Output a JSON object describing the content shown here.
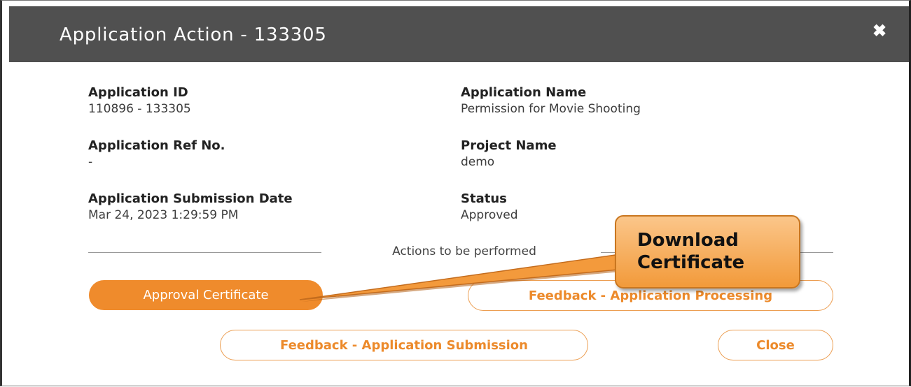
{
  "modal": {
    "title": "Application Action - 133305",
    "close_icon": "close-icon"
  },
  "details": {
    "application_id": {
      "label": "Application ID",
      "value": "110896 - 133305"
    },
    "application_name": {
      "label": "Application Name",
      "value": "Permission for Movie Shooting"
    },
    "application_ref_no": {
      "label": "Application Ref No.",
      "value": "-"
    },
    "project_name": {
      "label": "Project Name",
      "value": "demo"
    },
    "submission_date": {
      "label": "Application Submission Date",
      "value": "Mar 24, 2023 1:29:59 PM"
    },
    "status": {
      "label": "Status",
      "value": "Approved"
    }
  },
  "actions": {
    "heading": "Actions to be performed",
    "approval_certificate": "Approval Certificate",
    "feedback_processing": "Feedback - Application Processing",
    "feedback_submission": "Feedback - Application Submission",
    "close": "Close"
  },
  "callout": {
    "line1": "Download",
    "line2": "Certificate"
  },
  "colors": {
    "header_bg": "#505050",
    "accent": "#ef8b2c",
    "callout_fill": "#f5a348"
  }
}
